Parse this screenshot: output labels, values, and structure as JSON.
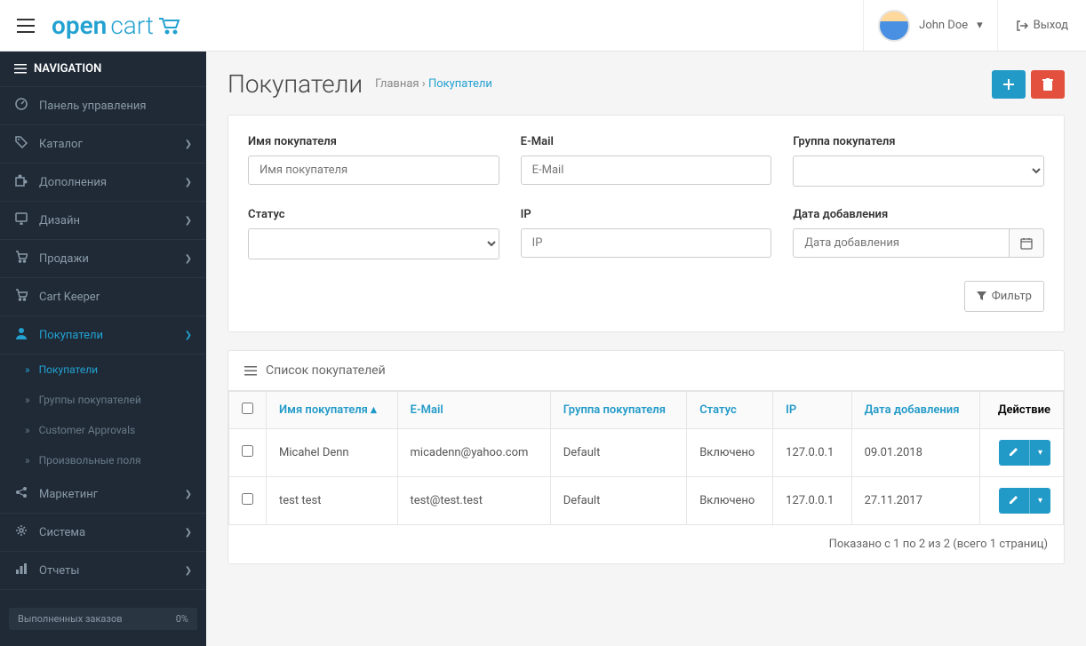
{
  "topbar": {
    "logo_part1": "open",
    "logo_part2": "cart",
    "user_name": "John Doe",
    "logout_label": "Выход"
  },
  "sidebar": {
    "header": "NAVIGATION",
    "items": [
      {
        "icon": "dashboard",
        "label": "Панель управления",
        "expand": false
      },
      {
        "icon": "tags",
        "label": "Каталог",
        "expand": true
      },
      {
        "icon": "puzzle",
        "label": "Дополнения",
        "expand": true
      },
      {
        "icon": "desktop",
        "label": "Дизайн",
        "expand": true
      },
      {
        "icon": "cart",
        "label": "Продажи",
        "expand": true
      },
      {
        "icon": "cart",
        "label": "Cart Keeper",
        "expand": false
      },
      {
        "icon": "user",
        "label": "Покупатели",
        "expand": true,
        "active": true
      },
      {
        "icon": "share",
        "label": "Маркетинг",
        "expand": true
      },
      {
        "icon": "cog",
        "label": "Система",
        "expand": true
      },
      {
        "icon": "chart",
        "label": "Отчеты",
        "expand": true
      }
    ],
    "sub_items": [
      {
        "label": "Покупатели",
        "active": true
      },
      {
        "label": "Группы покупателей",
        "active": false
      },
      {
        "label": "Customer Approvals",
        "active": false
      },
      {
        "label": "Произвольные поля",
        "active": false
      }
    ],
    "stat": {
      "label": "Выполненных заказов",
      "value": "0%"
    }
  },
  "page": {
    "title": "Покупатели",
    "breadcrumb_home": "Главная",
    "breadcrumb_sep": "›",
    "breadcrumb_current": "Покупатели"
  },
  "filter": {
    "name_label": "Имя покупателя",
    "name_placeholder": "Имя покупателя",
    "email_label": "E-Mail",
    "email_placeholder": "E-Mail",
    "group_label": "Группа покупателя",
    "status_label": "Статус",
    "ip_label": "IP",
    "ip_placeholder": "IP",
    "date_label": "Дата добавления",
    "date_placeholder": "Дата добавления",
    "filter_button": "Фильтр"
  },
  "table": {
    "heading": "Список покупателей",
    "columns": {
      "name": "Имя покупателя",
      "email": "E-Mail",
      "group": "Группа покупателя",
      "status": "Статус",
      "ip": "IP",
      "date": "Дата добавления",
      "action": "Действие"
    },
    "rows": [
      {
        "name": "Micahel Denn",
        "email": "micadenn@yahoo.com",
        "group": "Default",
        "status": "Включено",
        "ip": "127.0.0.1",
        "date": "09.01.2018"
      },
      {
        "name": "test test",
        "email": "test@test.test",
        "group": "Default",
        "status": "Включено",
        "ip": "127.0.0.1",
        "date": "27.11.2017"
      }
    ],
    "footer": "Показано с 1 по 2 из 2 (всего 1 страниц)"
  }
}
